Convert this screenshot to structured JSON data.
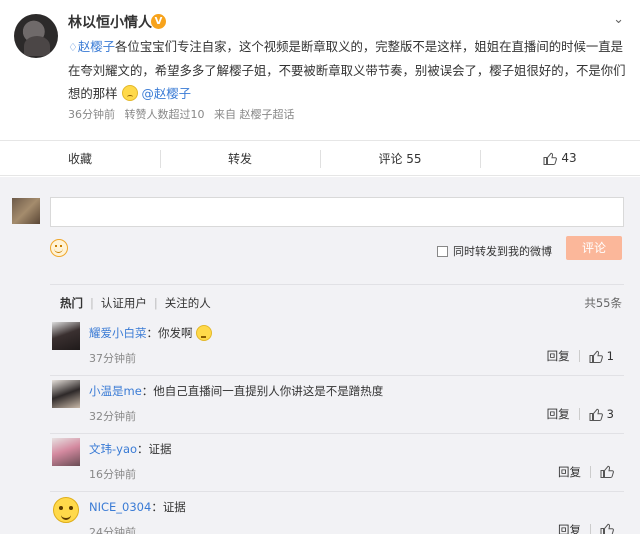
{
  "post": {
    "author": "林以恒小情人",
    "verify_badge": "V",
    "mention_prefix": "赵樱子",
    "text_main": "各位宝宝们专注自家，这个视频是断章取义的，完整版不是这样，姐姐在直播间的时候一直是在夸刘耀文的，希望多多了解樱子姐，不要被断章取义带节奏，别被误会了，樱子姐很好的，不是你们想的那样",
    "mention_suffix": "@赵樱子",
    "meta_time": "36分钟前",
    "meta_forward": "转赞人数超过10",
    "meta_source": "来自 赵樱子超话"
  },
  "actions": {
    "collect": "收藏",
    "forward": "转发",
    "comment": "评论 55",
    "like_count": "43"
  },
  "composer": {
    "forward_label": "同时转发到我的微博",
    "submit_label": "评论"
  },
  "filters": {
    "hot": "热门",
    "verified": "认证用户",
    "followed": "关注的人",
    "total": "共55条"
  },
  "comments": [
    {
      "user": "耀爱小白菜",
      "text": "你发啊",
      "time": "37分钟前",
      "reply": "回复",
      "likes": "1"
    },
    {
      "user": "小温是me",
      "text": "他自己直播间一直提别人你讲这是不是蹭热度",
      "time": "32分钟前",
      "reply": "回复",
      "likes": "3"
    },
    {
      "user": "文玮-yao",
      "text": "证据",
      "time": "16分钟前",
      "reply": "回复",
      "likes": ""
    },
    {
      "user": "NICE_0304",
      "text": "证据",
      "time": "24分钟前",
      "reply": "回复",
      "likes": ""
    }
  ],
  "colors": {
    "link": "#3a7bd5",
    "submit": "#fbb79a",
    "badge": "#f7a31c",
    "bg_comments": "#f2f2f5"
  }
}
